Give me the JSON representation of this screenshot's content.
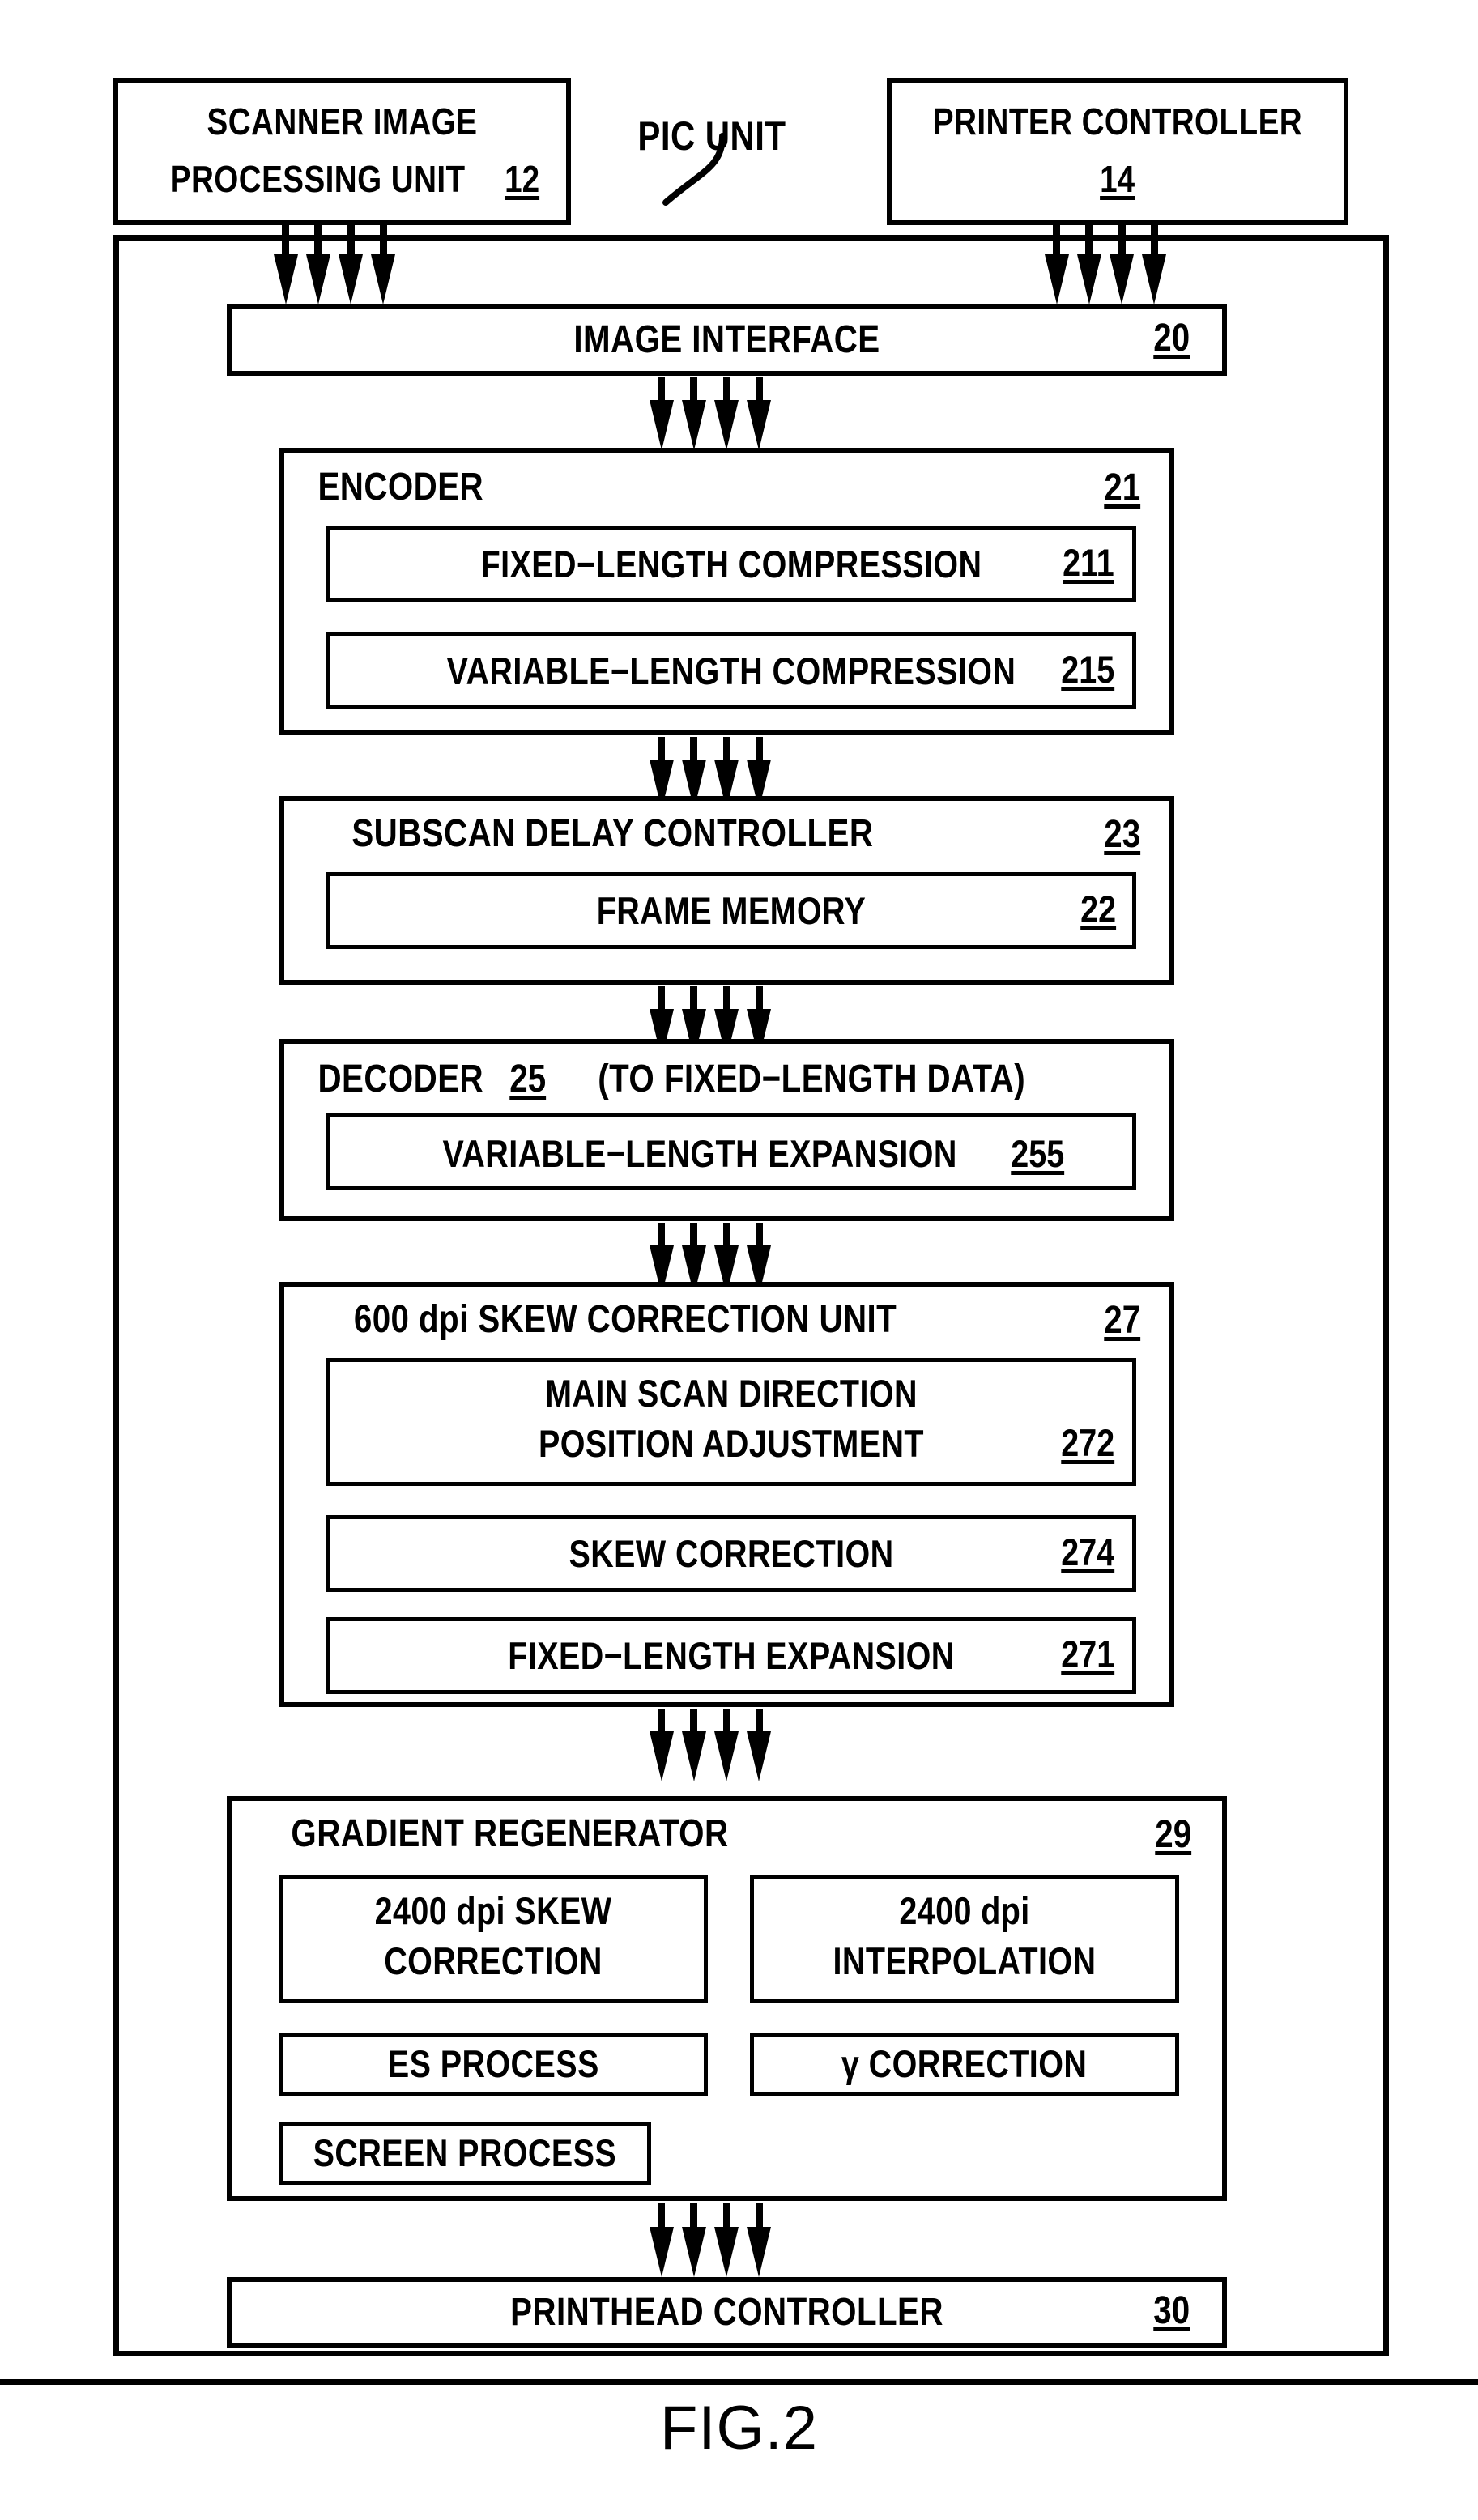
{
  "figure": {
    "caption": "FIG.2",
    "unit_label": "PIC UNIT"
  },
  "external_blocks": [
    {
      "id": "scanner-image-processing-unit",
      "line1": "SCANNER  IMAGE",
      "line2": "PROCESSING  UNIT",
      "ref": "12"
    },
    {
      "id": "printer-controller",
      "line1": "PRINTER  CONTROLLER",
      "line2": "",
      "ref": "14"
    }
  ],
  "pipeline": [
    {
      "id": "image-interface",
      "title": "IMAGE  INTERFACE",
      "ref": "20",
      "children": []
    },
    {
      "id": "encoder",
      "title": "ENCODER",
      "ref": "21",
      "children": [
        {
          "id": "fixed-length-compression",
          "title": "FIXED−LENGTH  COMPRESSION",
          "ref": "211"
        },
        {
          "id": "variable-length-compression",
          "title": "VARIABLE−LENGTH  COMPRESSION",
          "ref": "215"
        }
      ]
    },
    {
      "id": "subscan-delay-controller",
      "title": "SUBSCAN  DELAY  CONTROLLER",
      "ref": "23",
      "children": [
        {
          "id": "frame-memory",
          "title": "FRAME  MEMORY",
          "ref": "22"
        }
      ]
    },
    {
      "id": "decoder",
      "title": "DECODER",
      "ref": "25",
      "title_suffix": "(TO  FIXED−LENGTH  DATA)",
      "children": [
        {
          "id": "variable-length-expansion",
          "title": "VARIABLE−LENGTH  EXPANSION",
          "ref": "255"
        }
      ]
    },
    {
      "id": "skew-correction-unit-600dpi",
      "title": "600  dpi  SKEW  CORRECTION  UNIT",
      "ref": "27",
      "children": [
        {
          "id": "main-scan-direction-position-adjustment",
          "line1": "MAIN  SCAN  DIRECTION",
          "line2": "POSITION  ADJUSTMENT",
          "ref": "272"
        },
        {
          "id": "skew-correction",
          "title": "SKEW  CORRECTION",
          "ref": "274"
        },
        {
          "id": "fixed-length-expansion",
          "title": "FIXED−LENGTH  EXPANSION",
          "ref": "271"
        }
      ]
    },
    {
      "id": "gradient-regenerator",
      "title": "GRADIENT  REGENERATOR",
      "ref": "29",
      "children": [
        {
          "id": "skew-correction-2400dpi",
          "line1": "2400  dpi  SKEW",
          "line2": "CORRECTION",
          "ref": ""
        },
        {
          "id": "interpolation-2400dpi",
          "line1": "2400  dpi",
          "line2": "INTERPOLATION",
          "ref": ""
        },
        {
          "id": "es-process",
          "title": "ES  PROCESS",
          "ref": ""
        },
        {
          "id": "gamma-correction",
          "title": "γ  CORRECTION",
          "ref": ""
        },
        {
          "id": "screen-process",
          "title": "SCREEN  PROCESS",
          "ref": ""
        }
      ]
    },
    {
      "id": "printhead-controller",
      "title": "PRINTHEAD  CONTROLLER",
      "ref": "30",
      "children": []
    }
  ],
  "colors": {
    "ink": "#000000",
    "paper": "#ffffff"
  }
}
